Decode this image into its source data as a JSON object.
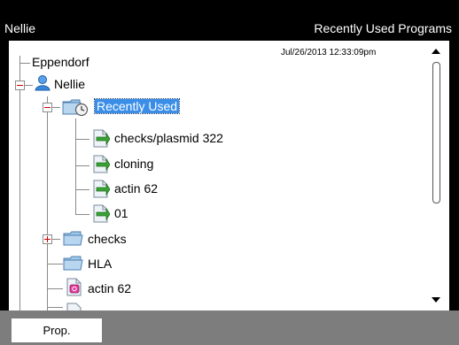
{
  "header": {
    "user": "Nellie",
    "view_title": "Recently Used Programs"
  },
  "tree": {
    "timestamp": "Jul/26/2013 12:33:09pm",
    "root": "Eppendorf",
    "user": "Nellie",
    "recent_folder": "Recently Used",
    "recent_items": [
      "checks/plasmid 322",
      "cloning",
      "actin 62",
      "01"
    ],
    "checks_folder": "checks",
    "hla_folder": "HLA",
    "actin_program": "actin 62"
  },
  "footer": {
    "prop_button": "Prop."
  },
  "colors": {
    "selection": "#3a8ee8",
    "footer": "#7d7d7d",
    "expander_sign": "#d00000"
  }
}
